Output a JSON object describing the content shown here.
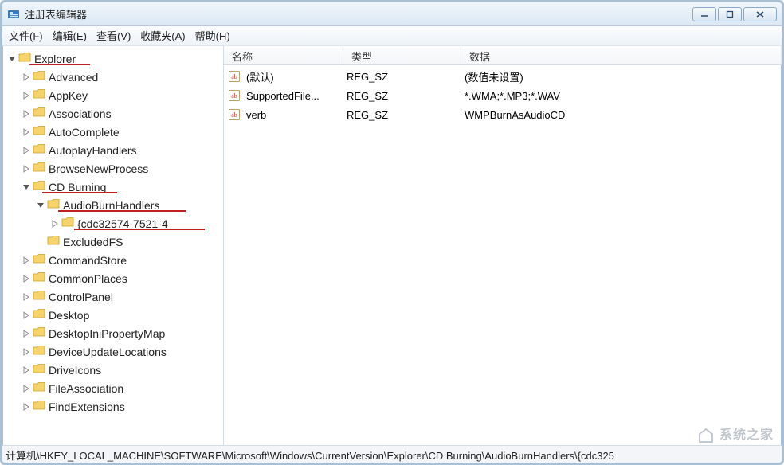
{
  "window": {
    "title": "注册表编辑器"
  },
  "menu": {
    "file": "文件(F)",
    "edit": "编辑(E)",
    "view": "查看(V)",
    "fav": "收藏夹(A)",
    "help": "帮助(H)"
  },
  "tree": {
    "root": "Explorer",
    "items": [
      {
        "label": "Advanced",
        "depth": 1,
        "expander": "closed"
      },
      {
        "label": "AppKey",
        "depth": 1,
        "expander": "closed"
      },
      {
        "label": "Associations",
        "depth": 1,
        "expander": "closed"
      },
      {
        "label": "AutoComplete",
        "depth": 1,
        "expander": "closed"
      },
      {
        "label": "AutoplayHandlers",
        "depth": 1,
        "expander": "closed"
      },
      {
        "label": "BrowseNewProcess",
        "depth": 1,
        "expander": "closed"
      },
      {
        "label": "CD Burning",
        "depth": 1,
        "expander": "open"
      },
      {
        "label": "AudioBurnHandlers",
        "depth": 2,
        "expander": "open"
      },
      {
        "label": "{cdc32574-7521-4",
        "depth": 3,
        "expander": "closed"
      },
      {
        "label": "ExcludedFS",
        "depth": 2,
        "expander": "none"
      },
      {
        "label": "CommandStore",
        "depth": 1,
        "expander": "closed"
      },
      {
        "label": "CommonPlaces",
        "depth": 1,
        "expander": "closed"
      },
      {
        "label": "ControlPanel",
        "depth": 1,
        "expander": "closed"
      },
      {
        "label": "Desktop",
        "depth": 1,
        "expander": "closed"
      },
      {
        "label": "DesktopIniPropertyMap",
        "depth": 1,
        "expander": "closed"
      },
      {
        "label": "DeviceUpdateLocations",
        "depth": 1,
        "expander": "closed"
      },
      {
        "label": "DriveIcons",
        "depth": 1,
        "expander": "closed"
      },
      {
        "label": "FileAssociation",
        "depth": 1,
        "expander": "closed"
      },
      {
        "label": "FindExtensions",
        "depth": 1,
        "expander": "closed"
      }
    ]
  },
  "list": {
    "headers": {
      "name": "名称",
      "type": "类型",
      "data": "数据"
    },
    "rows": [
      {
        "name": "(默认)",
        "type": "REG_SZ",
        "data": "(数值未设置)"
      },
      {
        "name": "SupportedFile...",
        "type": "REG_SZ",
        "data": "*.WMA;*.MP3;*.WAV"
      },
      {
        "name": "verb",
        "type": "REG_SZ",
        "data": "WMPBurnAsAudioCD"
      }
    ]
  },
  "statusbar": {
    "path": "计算机\\HKEY_LOCAL_MACHINE\\SOFTWARE\\Microsoft\\Windows\\CurrentVersion\\Explorer\\CD Burning\\AudioBurnHandlers\\{cdc325"
  },
  "watermark": {
    "text": "系统之家"
  }
}
